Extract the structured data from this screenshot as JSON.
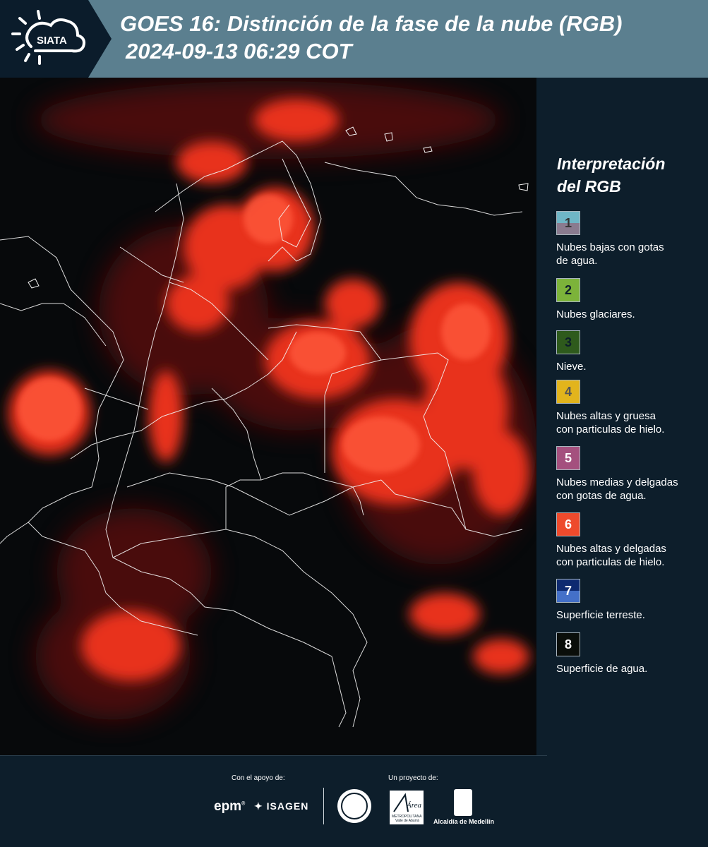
{
  "header": {
    "title_line1": "GOES 16: Distinción de la fase de la nube (RGB)",
    "title_line2": "2024-09-13 06:29 COT",
    "logo_text": "SIATA",
    "accent_color": "#5b7f8f"
  },
  "map": {
    "description_icon": "satellite-rgb-map",
    "cloud_color": "#ff3a20",
    "border_color": "#ffffff"
  },
  "legend": {
    "title_line1": "Interpretación",
    "title_line2": "del RGB",
    "items": [
      {
        "number": "1",
        "label_line1": "Nubes bajas con gotas",
        "label_line2": "de agua.",
        "color_top": "#6fb6c6",
        "color_bottom": "#8a7b8f",
        "number_color": "#333333"
      },
      {
        "number": "2",
        "label_line1": "Nubes glaciares.",
        "label_line2": "",
        "color_top": "#7cb33a",
        "color_bottom": "#7cb33a",
        "number_color": "#0d1e2b"
      },
      {
        "number": "3",
        "label_line1": "Nieve.",
        "label_line2": "",
        "color_top": "#2e5a1c",
        "color_bottom": "#2e5a1c",
        "number_color": "#0d1e2b"
      },
      {
        "number": "4",
        "label_line1": "Nubes altas y gruesa",
        "label_line2": "con particulas de hielo.",
        "color_top": "#e2b41c",
        "color_bottom": "#e2b41c",
        "number_color": "#555555"
      },
      {
        "number": "5",
        "label_line1": "Nubes medias y delgadas",
        "label_line2": "con gotas de agua.",
        "color_top": "#a4507e",
        "color_bottom": "#a4507e",
        "number_color": "#ffffff"
      },
      {
        "number": "6",
        "label_line1": "Nubes altas y delgadas",
        "label_line2": "con particulas de hielo.",
        "color_top": "#ee4a2c",
        "color_bottom": "#ee4a2c",
        "number_color": "#ffffff"
      },
      {
        "number": "7",
        "label_line1": "Superficie terreste.",
        "label_line2": "",
        "color_top": "#0e2a70",
        "color_bottom": "#4470c8",
        "number_color": "#ffffff"
      },
      {
        "number": "8",
        "label_line1": "Superficie de agua.",
        "label_line2": "",
        "color_top": "#0a0e0a",
        "color_bottom": "#0a0e0a",
        "number_color": "#ffffff"
      }
    ]
  },
  "footer": {
    "support_label": "Con el apoyo de:",
    "project_label": "Un proyecto de:",
    "epm": "epm",
    "isagen": "ISAGEN",
    "area": "Área",
    "area_sub": "METROPOLITANA Valle de Aburrá",
    "alcaldia": "Alcaldía de Medellín"
  }
}
